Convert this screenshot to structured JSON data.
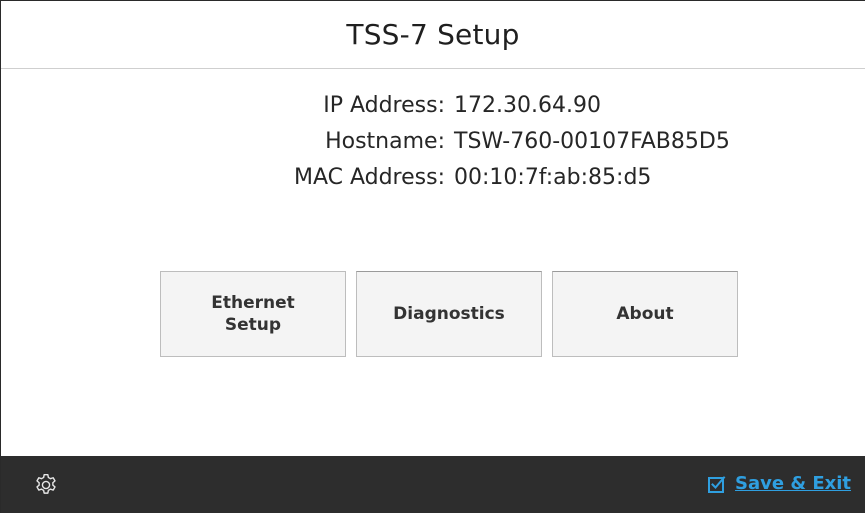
{
  "header": {
    "title": "TSS-7 Setup"
  },
  "info": {
    "rows": [
      {
        "label": "IP Address:",
        "value": "172.30.64.90"
      },
      {
        "label": "Hostname:",
        "value": "TSW-760-00107FAB85D5"
      },
      {
        "label": "MAC Address:",
        "value": "00:10:7f:ab:85:d5"
      }
    ]
  },
  "buttons": {
    "ethernet_line1": "Ethernet",
    "ethernet_line2": "Setup",
    "diagnostics": "Diagnostics",
    "about": "About"
  },
  "footer": {
    "settings_icon": "gear-icon",
    "save_icon": "checkbox-checked-icon",
    "save_label": "Save & Exit",
    "accent_color": "#2f9fe0"
  }
}
